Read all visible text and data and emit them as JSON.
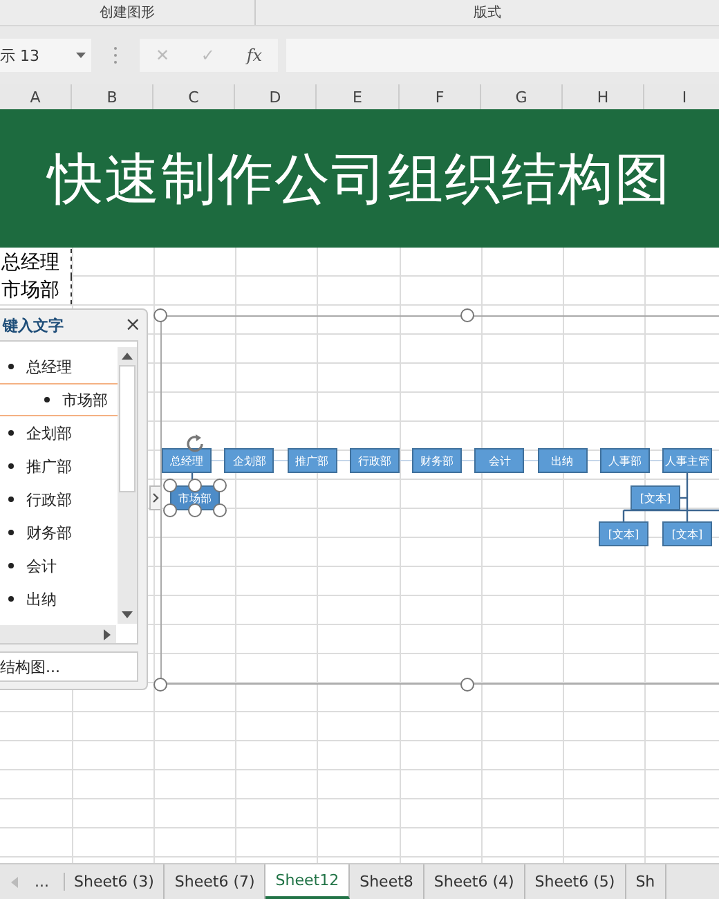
{
  "ribbon_groups": [
    "创建图形",
    "版式"
  ],
  "name_box": {
    "value": "示 13"
  },
  "formula_buttons": [
    "✕",
    "✓",
    "fx"
  ],
  "columns": [
    "A",
    "B",
    "C",
    "D",
    "E",
    "F",
    "G",
    "H",
    "I"
  ],
  "banner": {
    "title": "快速制作公司组织结构图"
  },
  "cells": [
    {
      "text": "总经理"
    },
    {
      "text": "市场部"
    }
  ],
  "text_pane": {
    "title": "键入文字",
    "close": "×",
    "footer_link": "结构图...",
    "items": [
      {
        "text": "总经理",
        "selected": false,
        "children": [
          {
            "text": "市场部",
            "selected": true
          }
        ]
      },
      {
        "text": "企划部",
        "selected": false
      },
      {
        "text": "推广部",
        "selected": false
      },
      {
        "text": "行政部",
        "selected": false
      },
      {
        "text": "财务部",
        "selected": false
      },
      {
        "text": "会计",
        "selected": false
      },
      {
        "text": "出纳",
        "selected": false
      }
    ]
  },
  "diagram": {
    "nodes": [
      {
        "text": "总经理",
        "selected": false,
        "children": [
          {
            "text": "市场部",
            "kind": "subordinate",
            "selected": true
          }
        ]
      },
      {
        "text": "企划部",
        "selected": false
      },
      {
        "text": "推广部",
        "selected": false
      },
      {
        "text": "行政部",
        "selected": false
      },
      {
        "text": "财务部",
        "selected": false
      },
      {
        "text": "会计",
        "selected": false
      },
      {
        "text": "出纳",
        "selected": false
      },
      {
        "text": "人事部",
        "selected": false
      },
      {
        "text": "人事主管",
        "selected": false,
        "children": [
          {
            "text": "[文本]",
            "kind": "assistant",
            "selected": false
          },
          {
            "text": "[文本]",
            "kind": "subordinate",
            "selected": false
          },
          {
            "text": "[文本]",
            "kind": "subordinate",
            "selected": false
          }
        ]
      }
    ]
  },
  "sheet_tabs": {
    "more": "...",
    "tabs": [
      {
        "label": "Sheet6 (3)",
        "selected": false
      },
      {
        "label": "Sheet6 (7)",
        "selected": false
      },
      {
        "label": "Sheet12",
        "selected": true
      },
      {
        "label": "Sheet8",
        "selected": false
      },
      {
        "label": "Sheet6 (4)",
        "selected": false
      },
      {
        "label": "Sheet6 (5)",
        "selected": false
      },
      {
        "label": "Sh",
        "selected": false
      }
    ]
  }
}
